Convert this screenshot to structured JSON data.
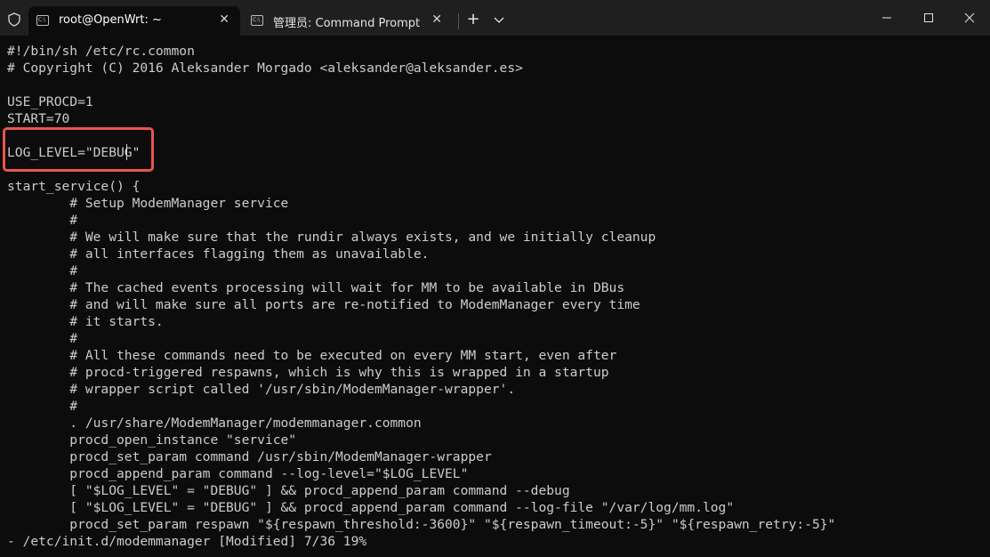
{
  "tabs": [
    {
      "label": "root@OpenWrt: ~",
      "icon": "terminal-icon",
      "close": "✕"
    },
    {
      "label": "管理员: Command Prompt",
      "icon": "terminal-icon",
      "close": "✕"
    }
  ],
  "new_tab": "+",
  "terminal_lines": [
    "#!/bin/sh /etc/rc.common",
    "# Copyright (C) 2016 Aleksander Morgado <aleksander@aleksander.es>",
    "",
    "USE_PROCD=1",
    "START=70",
    "",
    "LOG_LEVEL=\"DEBUG\"",
    "",
    "start_service() {",
    "        # Setup ModemManager service",
    "        #",
    "        # We will make sure that the rundir always exists, and we initially cleanup",
    "        # all interfaces flagging them as unavailable.",
    "        #",
    "        # The cached events processing will wait for MM to be available in DBus",
    "        # and will make sure all ports are re-notified to ModemManager every time",
    "        # it starts.",
    "        #",
    "        # All these commands need to be executed on every MM start, even after",
    "        # procd-triggered respawns, which is why this is wrapped in a startup",
    "        # wrapper script called '/usr/sbin/ModemManager-wrapper'.",
    "        #",
    "        . /usr/share/ModemManager/modemmanager.common",
    "        procd_open_instance \"service\"",
    "        procd_set_param command /usr/sbin/ModemManager-wrapper",
    "        procd_append_param command --log-level=\"$LOG_LEVEL\"",
    "        [ \"$LOG_LEVEL\" = \"DEBUG\" ] && procd_append_param command --debug",
    "        [ \"$LOG_LEVEL\" = \"DEBUG\" ] && procd_append_param command --log-file \"/var/log/mm.log\"",
    "        procd_set_param respawn \"${respawn_threshold:-3600}\" \"${respawn_timeout:-5}\" \"${respawn_retry:-5}\""
  ],
  "status_line": "- /etc/init.d/modemmanager [Modified] 7/36 19%",
  "colors": {
    "terminal_bg": "#0c0c0c",
    "titlebar_bg": "#1f1f1f",
    "text": "#cccccc",
    "highlight": "#e8554e"
  }
}
